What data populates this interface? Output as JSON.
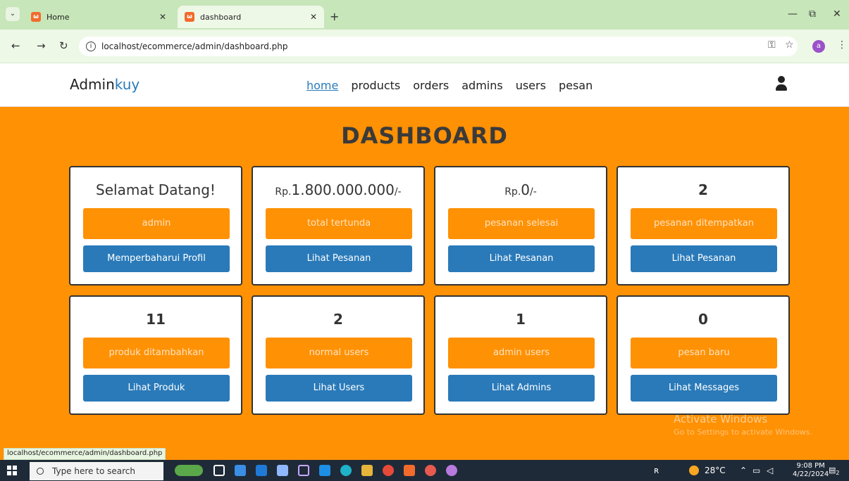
{
  "browser": {
    "tabs": [
      {
        "label": "Home",
        "active": false
      },
      {
        "label": "dashboard",
        "active": true
      }
    ],
    "url": "localhost/ecommerce/admin/dashboard.php",
    "profile_initial": "a",
    "status_url": "localhost/ecommerce/admin/dashboard.php"
  },
  "site": {
    "logo_main": "Admin",
    "logo_accent": "kuy",
    "nav": [
      "home",
      "products",
      "orders",
      "admins",
      "users",
      "pesan"
    ],
    "active_nav": "home"
  },
  "page": {
    "heading": "DASHBOARD",
    "cards": [
      {
        "value": "Selamat Datang!",
        "label": "admin",
        "button": "Memperbaharui Profil"
      },
      {
        "prefix": "Rp.",
        "amount": "1.800.000.000",
        "suffix": "/-",
        "label": "total tertunda",
        "button": "Lihat Pesanan"
      },
      {
        "prefix": "Rp.",
        "amount": "0",
        "suffix": "/-",
        "label": "pesanan selesai",
        "button": "Lihat Pesanan"
      },
      {
        "value": "2",
        "label": "pesanan ditempatkan",
        "button": "Lihat Pesanan"
      },
      {
        "value": "11",
        "label": "produk ditambahkan",
        "button": "Lihat Produk"
      },
      {
        "value": "2",
        "label": "normal users",
        "button": "Lihat Users"
      },
      {
        "value": "1",
        "label": "admin users",
        "button": "Lihat Admins"
      },
      {
        "value": "0",
        "label": "pesan baru",
        "button": "Lihat Messages"
      }
    ]
  },
  "watermark": {
    "line1": "Activate Windows",
    "line2": "Go to Settings to activate Windows."
  },
  "taskbar": {
    "search_placeholder": "Type here to search",
    "weather": "28°C",
    "time": "9:08 PM",
    "date": "4/22/2024",
    "notification_count": "2"
  },
  "colors": {
    "accent": "#ff9104",
    "button": "#2a7ab9",
    "tabbar": "#c7e6b9"
  }
}
